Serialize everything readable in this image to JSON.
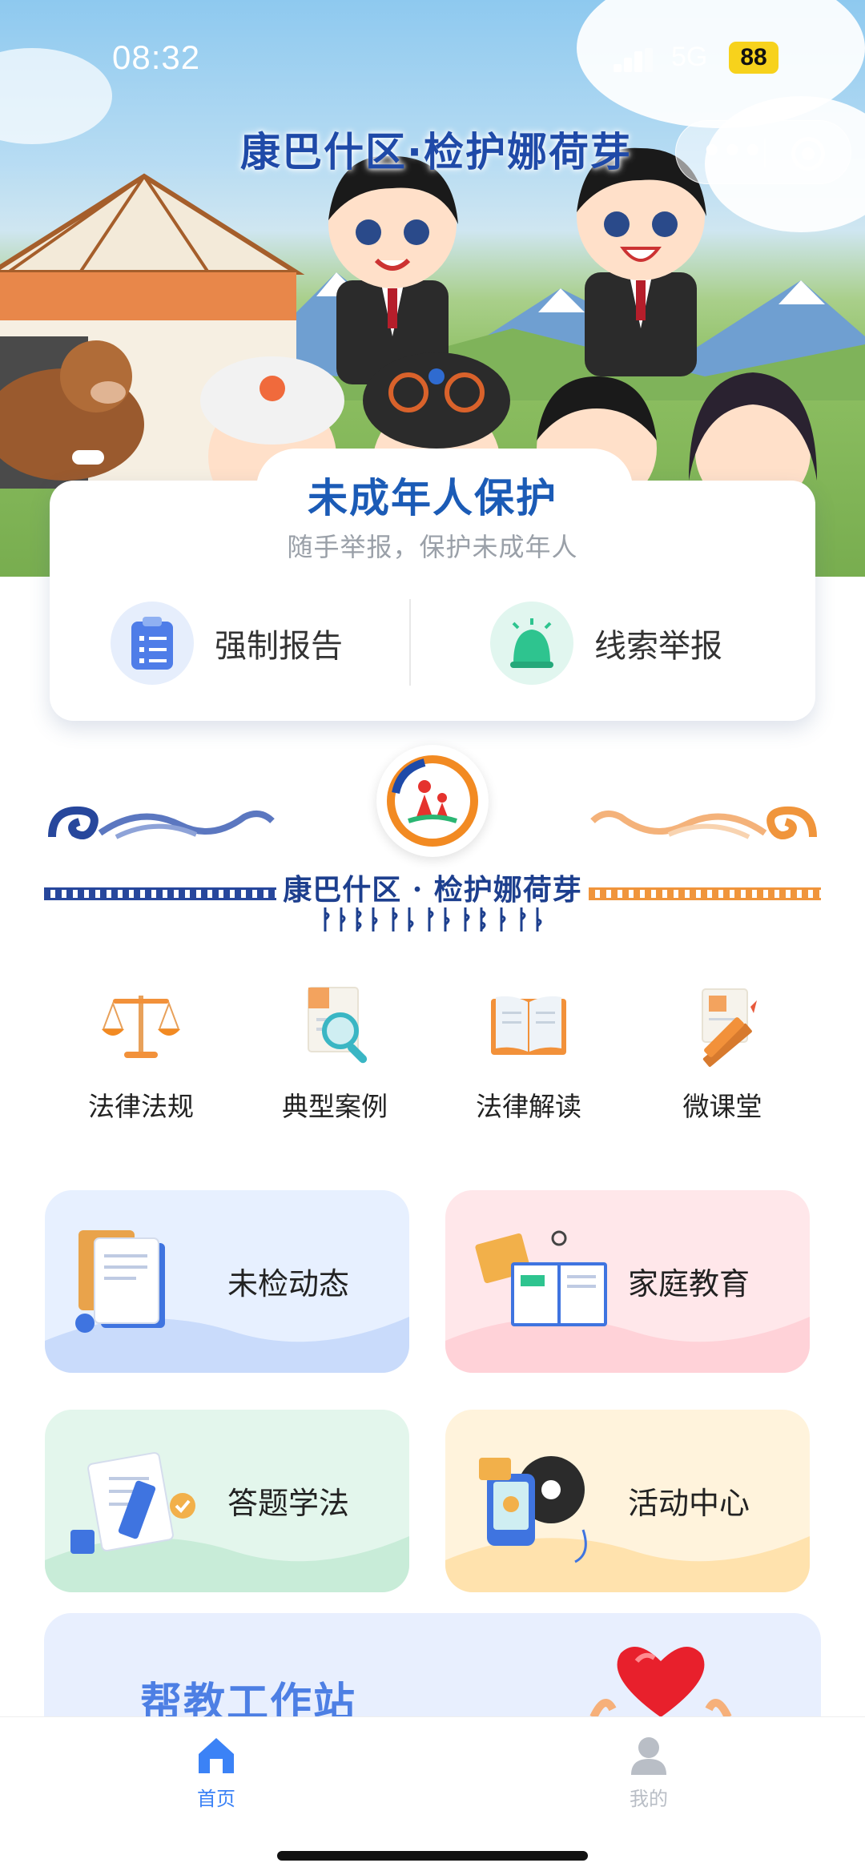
{
  "status_bar": {
    "time": "08:32",
    "network": "5G",
    "battery": "88"
  },
  "hero": {
    "title": "康巴什区·检护娜荷芽"
  },
  "protection": {
    "title": "未成年人保护",
    "subtitle": "随手举报，保护未成年人",
    "actions": [
      {
        "label": "强制报告",
        "icon": "clipboard-icon"
      },
      {
        "label": "线索举报",
        "icon": "alarm-bell-icon"
      }
    ]
  },
  "brand": {
    "name": "康巴什区 · 检护娜荷芽"
  },
  "grid": [
    {
      "label": "法律法规",
      "icon": "scales-icon"
    },
    {
      "label": "典型案例",
      "icon": "magnifier-document-icon"
    },
    {
      "label": "法律解读",
      "icon": "open-book-icon"
    },
    {
      "label": "微课堂",
      "icon": "ruler-pencil-icon"
    }
  ],
  "features": [
    {
      "label": "未检动态",
      "icon": "documents-icon",
      "color": "#e7f0ff"
    },
    {
      "label": "家庭教育",
      "icon": "books-icon",
      "color": "#ffe7ea"
    },
    {
      "label": "答题学法",
      "icon": "checklist-icon",
      "color": "#e3f6ec"
    },
    {
      "label": "活动中心",
      "icon": "record-player-icon",
      "color": "#fff3dc"
    }
  ],
  "station": {
    "title": "帮教工作站"
  },
  "tabbar": [
    {
      "label": "首页",
      "icon": "home-icon",
      "active": true
    },
    {
      "label": "我的",
      "icon": "user-icon",
      "active": false
    }
  ],
  "colors": {
    "primary": "#1b5bb6",
    "tab_active": "#3b82f6",
    "tab_inactive": "#b9bec6"
  }
}
